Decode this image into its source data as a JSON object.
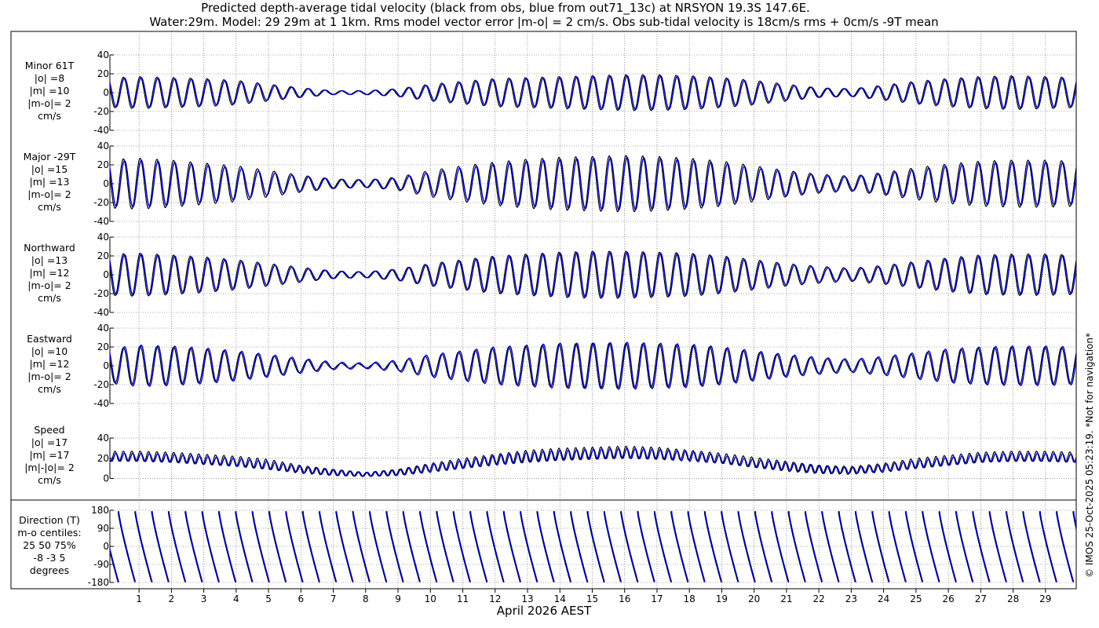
{
  "title_line1": "Predicted depth-average tidal velocity (black from obs, blue from out71_13c) at NRSYON 19.3S 147.6E.",
  "title_line2": "Water:29m. Model: 29 29m at 1 1km. Rms model vector error |m-o| = 2 cm/s. Obs sub-tidal velocity is 18cm/s rms + 0cm/s -9T mean",
  "xlabel": "April 2026 AEST",
  "copyright": "© IMOS 25-Oct-2025 05:23:19. *Not for navigation*",
  "colors": {
    "obs": "#000000",
    "model": "#0000cc",
    "grid": "#555555"
  },
  "chart_data": {
    "type": "line",
    "x_axis": {
      "unit": "day of April 2026 (AEST)",
      "range": [
        0.1,
        29.95
      ],
      "ticks": [
        1,
        2,
        3,
        4,
        5,
        6,
        7,
        8,
        9,
        10,
        11,
        12,
        13,
        14,
        15,
        16,
        17,
        18,
        19,
        20,
        21,
        22,
        23,
        24,
        25,
        26,
        27,
        28,
        29
      ],
      "tick_labels": [
        "1",
        "2",
        "3",
        "4",
        "5",
        "6",
        "7",
        "8",
        "9",
        "10",
        "11",
        "12",
        "13",
        "14",
        "15",
        "16",
        "17",
        "18",
        "19",
        "20",
        "21",
        "22",
        "23",
        "24",
        "25",
        "26",
        "27",
        "28",
        "29"
      ],
      "grid": true
    },
    "tidal_period_days": 0.5175,
    "series_legend": {
      "obs": "black from obs",
      "model": "blue from out71_13c"
    },
    "panels": [
      {
        "id": "minor",
        "label_lines": [
          "Minor 61T",
          "|o| =8",
          "|m| =10",
          "|m-o|= 2",
          "cm/s"
        ],
        "ylim": [
          -40,
          40
        ],
        "yticks": [
          -40,
          -20,
          0,
          20,
          40
        ],
        "ytick_labels": [
          "-40",
          "-20",
          "0",
          "20",
          "40"
        ],
        "kind": "oscillation",
        "envelope_days": [
          0.2,
          1,
          2,
          3,
          4,
          5,
          6,
          7,
          8,
          9,
          10,
          11,
          12,
          13,
          14,
          15,
          16,
          17,
          18,
          19,
          20,
          21,
          22,
          23,
          24,
          25,
          26,
          27,
          28,
          29,
          29.95
        ],
        "obs_amplitude": [
          16,
          17,
          16,
          15,
          13,
          9,
          5,
          2,
          2,
          4,
          9,
          12,
          15,
          16,
          17,
          18,
          19,
          19,
          18,
          16,
          13,
          9,
          5,
          4,
          8,
          12,
          15,
          17,
          18,
          17,
          16
        ],
        "model_amplitude": [
          15,
          16,
          15,
          14,
          12,
          8,
          5,
          2,
          2,
          4,
          8,
          11,
          14,
          15,
          16,
          17,
          18,
          18,
          17,
          15,
          12,
          8,
          5,
          4,
          7,
          11,
          14,
          16,
          17,
          16,
          15
        ]
      },
      {
        "id": "major",
        "label_lines": [
          "Major -29T",
          "|o| =15",
          "|m| =13",
          "|m-o|= 2",
          "cm/s"
        ],
        "ylim": [
          -40,
          40
        ],
        "yticks": [
          -40,
          -20,
          0,
          20,
          40
        ],
        "ytick_labels": [
          "-40",
          "-20",
          "0",
          "20",
          "40"
        ],
        "kind": "oscillation",
        "envelope_days": [
          0.2,
          1,
          2,
          3,
          4,
          5,
          6,
          7,
          8,
          9,
          10,
          11,
          12,
          13,
          14,
          15,
          16,
          17,
          18,
          19,
          20,
          21,
          22,
          23,
          24,
          25,
          26,
          27,
          28,
          29,
          29.95
        ],
        "obs_amplitude": [
          26,
          27,
          25,
          22,
          19,
          14,
          9,
          5,
          4,
          7,
          14,
          19,
          23,
          26,
          28,
          29,
          30,
          29,
          27,
          24,
          19,
          14,
          10,
          8,
          12,
          17,
          21,
          24,
          25,
          25,
          24
        ],
        "model_amplitude": [
          24,
          25,
          23,
          20,
          17,
          12,
          8,
          5,
          4,
          6,
          12,
          17,
          21,
          24,
          26,
          27,
          28,
          27,
          25,
          22,
          17,
          13,
          9,
          7,
          11,
          15,
          19,
          22,
          23,
          23,
          22
        ]
      },
      {
        "id": "northward",
        "label_lines": [
          "Northward",
          "|o| =13",
          "|m| =12",
          "|m-o|= 2",
          "cm/s"
        ],
        "ylim": [
          -40,
          40
        ],
        "yticks": [
          -40,
          -20,
          0,
          20,
          40
        ],
        "ytick_labels": [
          "-40",
          "-20",
          "0",
          "20",
          "40"
        ],
        "kind": "oscillation",
        "envelope_days": [
          0.2,
          1,
          2,
          3,
          4,
          5,
          6,
          7,
          8,
          9,
          10,
          11,
          12,
          13,
          14,
          15,
          16,
          17,
          18,
          19,
          20,
          21,
          22,
          23,
          24,
          25,
          26,
          27,
          28,
          29,
          29.95
        ],
        "obs_amplitude": [
          22,
          23,
          21,
          19,
          16,
          12,
          8,
          4,
          3,
          6,
          12,
          16,
          20,
          22,
          24,
          25,
          25,
          24,
          23,
          20,
          16,
          12,
          9,
          7,
          10,
          14,
          18,
          21,
          22,
          22,
          21
        ],
        "model_amplitude": [
          21,
          22,
          20,
          18,
          15,
          11,
          7,
          4,
          3,
          6,
          11,
          15,
          19,
          21,
          23,
          24,
          24,
          23,
          22,
          19,
          15,
          11,
          8,
          6,
          9,
          13,
          17,
          20,
          21,
          21,
          20
        ]
      },
      {
        "id": "eastward",
        "label_lines": [
          "Eastward",
          "|o| =10",
          "|m| =12",
          "|m-o|= 2",
          "cm/s"
        ],
        "ylim": [
          -40,
          40
        ],
        "yticks": [
          -40,
          -20,
          0,
          20,
          40
        ],
        "ytick_labels": [
          "-40",
          "-20",
          "0",
          "20",
          "40"
        ],
        "kind": "oscillation",
        "envelope_days": [
          0.2,
          1,
          2,
          3,
          4,
          5,
          6,
          7,
          8,
          9,
          10,
          11,
          12,
          13,
          14,
          15,
          16,
          17,
          18,
          19,
          20,
          21,
          22,
          23,
          24,
          25,
          26,
          27,
          28,
          29,
          29.95
        ],
        "obs_amplitude": [
          18,
          21,
          20,
          18,
          15,
          11,
          7,
          3,
          2,
          5,
          11,
          15,
          19,
          21,
          23,
          24,
          24,
          23,
          22,
          19,
          15,
          11,
          8,
          6,
          9,
          13,
          17,
          19,
          20,
          20,
          19
        ],
        "model_amplitude": [
          19,
          22,
          21,
          19,
          16,
          12,
          8,
          4,
          3,
          6,
          12,
          16,
          20,
          22,
          24,
          24,
          25,
          24,
          23,
          20,
          16,
          12,
          9,
          7,
          10,
          14,
          18,
          20,
          21,
          21,
          20
        ]
      },
      {
        "id": "speed",
        "label_lines": [
          "Speed",
          "|o| =17",
          "|m| =17",
          "|m|-|o|= 2",
          "cm/s"
        ],
        "ylim": [
          -5,
          40
        ],
        "yticks": [
          0,
          20,
          40
        ],
        "ytick_labels": [
          "0",
          "20",
          "40"
        ],
        "kind": "speed",
        "envelope_days": [
          0.2,
          1,
          2,
          3,
          4,
          5,
          6,
          7,
          8,
          9,
          10,
          11,
          12,
          13,
          14,
          15,
          16,
          17,
          18,
          19,
          20,
          21,
          22,
          23,
          24,
          25,
          26,
          27,
          28,
          29,
          29.95
        ],
        "obs_mean": [
          22,
          22,
          21,
          19,
          17,
          14,
          9,
          6,
          4,
          6,
          11,
          15,
          19,
          22,
          24,
          25,
          26,
          25,
          23,
          20,
          16,
          12,
          9,
          8,
          11,
          15,
          18,
          21,
          22,
          22,
          21
        ],
        "obs_ripple": [
          5,
          5,
          5,
          5,
          5,
          5,
          4,
          3,
          2,
          3,
          4,
          5,
          5,
          6,
          6,
          6,
          6,
          6,
          5,
          5,
          5,
          5,
          4,
          4,
          4,
          5,
          5,
          5,
          5,
          5,
          5
        ],
        "model_mean": [
          21,
          21,
          20,
          18,
          16,
          13,
          9,
          6,
          4,
          6,
          10,
          14,
          18,
          21,
          23,
          24,
          25,
          24,
          22,
          19,
          15,
          12,
          9,
          8,
          10,
          14,
          17,
          20,
          21,
          21,
          20
        ],
        "model_ripple": [
          4,
          4,
          4,
          4,
          4,
          4,
          3,
          3,
          2,
          3,
          4,
          4,
          5,
          5,
          5,
          5,
          5,
          5,
          5,
          4,
          4,
          4,
          4,
          3,
          4,
          4,
          4,
          4,
          4,
          4,
          4
        ]
      },
      {
        "id": "direction",
        "label_lines": [
          "Direction (T)",
          "m-o centiles:",
          "25  50  75%",
          "-8 -3  5",
          "degrees"
        ],
        "ylim": [
          -180,
          180
        ],
        "yticks": [
          -180,
          -90,
          0,
          90,
          180
        ],
        "ytick_labels": [
          "-180",
          "-90",
          "0",
          "90",
          "180"
        ],
        "kind": "direction",
        "sawtooth_start_deg": 175,
        "sawtooth_end_deg": -178
      }
    ]
  }
}
